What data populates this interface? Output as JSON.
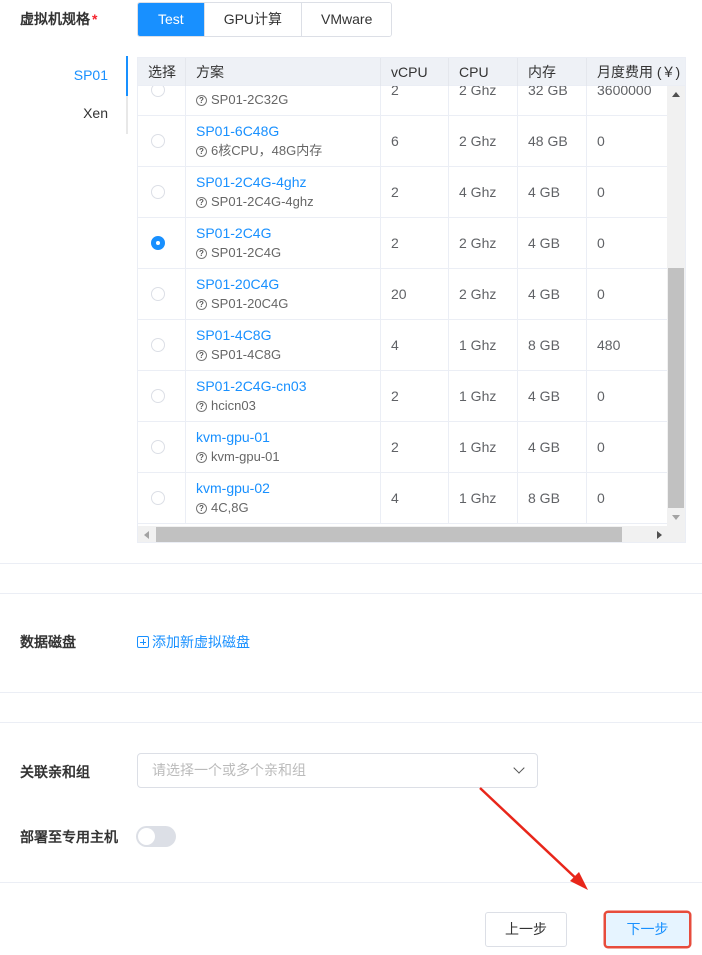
{
  "spec": {
    "label": "虚拟机规格",
    "required_mark": "*",
    "tabs": [
      "Test",
      "GPU计算",
      "VMware"
    ],
    "side_tabs": [
      "SP01",
      "Xen"
    ]
  },
  "table": {
    "headers": [
      "选择",
      "方案",
      "vCPU",
      "CPU",
      "内存",
      "月度费用 (￥)"
    ],
    "rows": [
      {
        "name": "",
        "desc": "SP01-2C32G",
        "vcpu": "2",
        "cpu": "2 Ghz",
        "mem": "32 GB",
        "fee": "3600000",
        "selected": false
      },
      {
        "name": "SP01-6C48G",
        "desc": "6核CPU，48G内存",
        "vcpu": "6",
        "cpu": "2 Ghz",
        "mem": "48 GB",
        "fee": "0",
        "selected": false
      },
      {
        "name": "SP01-2C4G-4ghz",
        "desc": "SP01-2C4G-4ghz",
        "vcpu": "2",
        "cpu": "4 Ghz",
        "mem": "4 GB",
        "fee": "0",
        "selected": false
      },
      {
        "name": "SP01-2C4G",
        "desc": "SP01-2C4G",
        "vcpu": "2",
        "cpu": "2 Ghz",
        "mem": "4 GB",
        "fee": "0",
        "selected": true
      },
      {
        "name": "SP01-20C4G",
        "desc": "SP01-20C4G",
        "vcpu": "20",
        "cpu": "2 Ghz",
        "mem": "4 GB",
        "fee": "0",
        "selected": false
      },
      {
        "name": "SP01-4C8G",
        "desc": "SP01-4C8G",
        "vcpu": "4",
        "cpu": "1 Ghz",
        "mem": "8 GB",
        "fee": "480",
        "selected": false
      },
      {
        "name": "SP01-2C4G-cn03",
        "desc": "hcicn03",
        "vcpu": "2",
        "cpu": "1 Ghz",
        "mem": "4 GB",
        "fee": "0",
        "selected": false
      },
      {
        "name": "kvm-gpu-01",
        "desc": "kvm-gpu-01",
        "vcpu": "2",
        "cpu": "1 Ghz",
        "mem": "4 GB",
        "fee": "0",
        "selected": false
      },
      {
        "name": "kvm-gpu-02",
        "desc": "4C,8G",
        "vcpu": "4",
        "cpu": "1 Ghz",
        "mem": "8 GB",
        "fee": "0",
        "selected": false
      }
    ]
  },
  "disk": {
    "label": "数据磁盘",
    "add_label": "添加新虚拟磁盘"
  },
  "affinity": {
    "label": "关联亲和组",
    "placeholder": "请选择一个或多个亲和组"
  },
  "dedicated": {
    "label": "部署至专用主机",
    "enabled": false
  },
  "footer": {
    "prev_label": "上一步",
    "next_label": "下一步"
  },
  "colors": {
    "accent": "#1890ff",
    "highlight": "#e74c3c"
  }
}
